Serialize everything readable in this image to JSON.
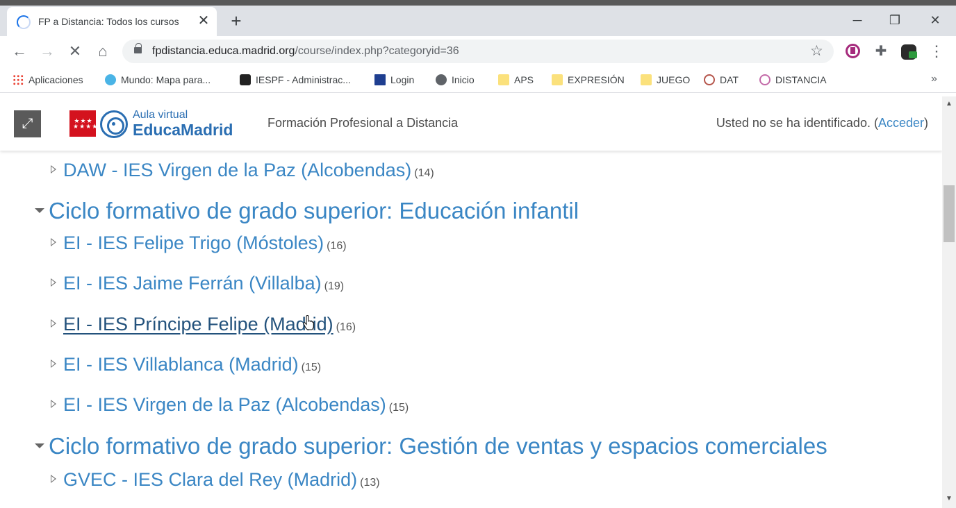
{
  "browser": {
    "tab_title": "FP a Distancia: Todos los cursos",
    "tab_close": "✕",
    "new_tab": "+",
    "window_controls": {
      "minimize": "─",
      "maximize": "❐",
      "close": "✕"
    },
    "url_host": "fpdistancia.educa.madrid.org",
    "url_path": "/course/index.php?categoryid=36",
    "icons": [
      "loading-spinner-icon",
      "back-arrow-icon",
      "forward-arrow-icon",
      "stop-icon",
      "home-icon",
      "lock-icon",
      "star-icon",
      "extension-icon",
      "puzzle-icon",
      "menu-icon"
    ]
  },
  "bookmarks": [
    {
      "label": "Aplicaciones",
      "icon": "apps-grid-icon"
    },
    {
      "label": "Mundo: Mapa para...",
      "icon": "globe-icon"
    },
    {
      "label": "IESPF - Administrac...",
      "icon": "iespf-icon"
    },
    {
      "label": "Login",
      "icon": "eu-flag-icon"
    },
    {
      "label": "Inicio",
      "icon": "globe-icon"
    },
    {
      "label": "APS",
      "icon": "folder-icon"
    },
    {
      "label": "EXPRESIÓN",
      "icon": "folder-icon"
    },
    {
      "label": "JUEGO",
      "icon": "folder-icon"
    },
    {
      "label": "DAT",
      "icon": "dat-icon"
    },
    {
      "label": "DISTANCIA",
      "icon": "distancia-icon"
    }
  ],
  "bookmarks_more": "»",
  "header": {
    "expand": "⤢",
    "flag_stars": "★★★ ★★★★",
    "aula": "Aula virtual",
    "brand": "EducaMadrid",
    "site_name": "Formación Profesional a Distancia",
    "login_prefix": "Usted no se ha identificado. (",
    "login_link": "Acceder",
    "login_suffix": ")"
  },
  "categories": [
    {
      "title": "",
      "courses": [
        {
          "name": "DAW - IES Virgen de la Paz (Alcobendas)",
          "count": "(14)"
        }
      ]
    },
    {
      "title": "Ciclo formativo de grado superior: Educación infantil",
      "courses": [
        {
          "name": "EI - IES Felipe Trigo (Móstoles)",
          "count": "(16)"
        },
        {
          "name": "EI - IES Jaime Ferrán (Villalba)",
          "count": "(19)"
        },
        {
          "name": "EI - IES Príncipe Felipe (Madrid)",
          "count": "(16)"
        },
        {
          "name": "EI - IES Villablanca (Madrid)",
          "count": "(15)"
        },
        {
          "name": "EI - IES Virgen de la Paz (Alcobendas)",
          "count": "(15)"
        }
      ]
    },
    {
      "title": "Ciclo formativo de grado superior: Gestión de ventas y espacios comerciales",
      "courses": [
        {
          "name": "GVEC - IES Clara del Rey (Madrid)",
          "count": "(13)"
        }
      ]
    }
  ],
  "scrollbar": {
    "up": "▲",
    "down": "▼"
  }
}
